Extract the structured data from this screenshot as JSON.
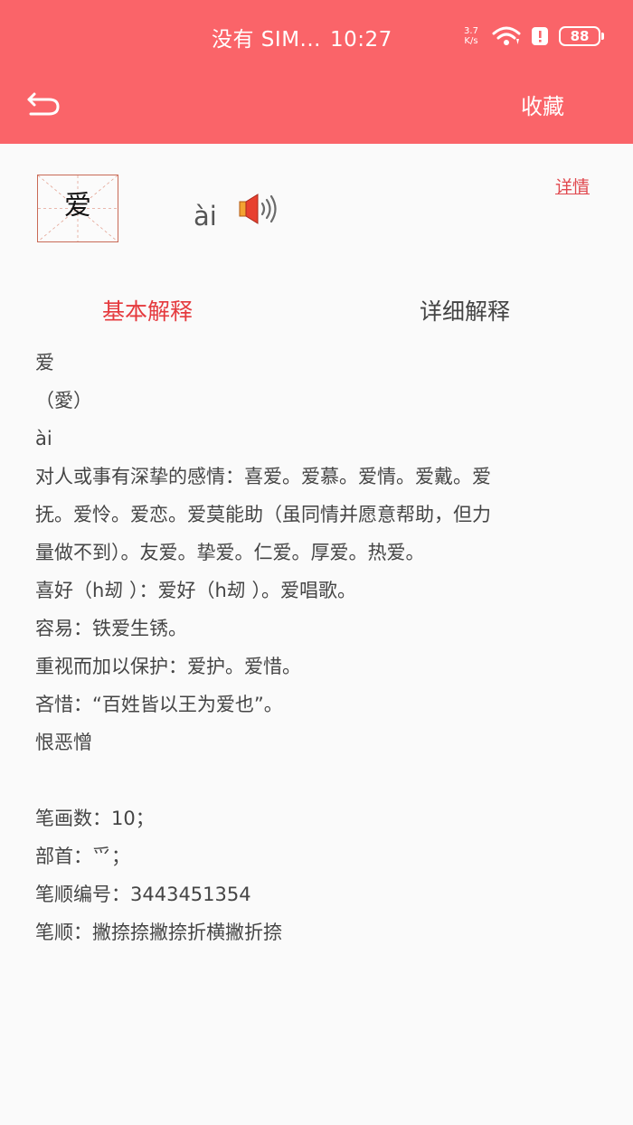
{
  "status_bar": {
    "carrier": "没有 SIM...",
    "time": "10:27",
    "net_speed_value": "3.7",
    "net_speed_unit": "K/s",
    "battery": "88"
  },
  "toolbar": {
    "favorite_label": "收藏"
  },
  "character": {
    "glyph": "爱",
    "pinyin": "ài",
    "detail_link": "详情"
  },
  "tabs": [
    {
      "label": "基本解释",
      "active": true
    },
    {
      "label": "详细解释",
      "active": false
    }
  ],
  "definition": {
    "lines": [
      "爱",
      "（愛）",
      "ài",
      "对人或事有深挚的感情：喜爱。爱慕。爱情。爱戴。爱",
      "抚。爱怜。爱恋。爱莫能助（虽同情并愿意帮助，但力",
      "量做不到）。友爱。挚爱。仁爱。厚爱。热爱。",
      "喜好（h刼 ）：爱好（h刼 ）。爱唱歌。",
      "容易：铁爱生锈。",
      "重视而加以保护：爱护。爱惜。",
      "吝惜：“百姓皆以王为爱也”。",
      "恨恶憎"
    ]
  },
  "info": {
    "strokes": "笔画数：10；",
    "radical": "部首：爫；",
    "stroke_code": "笔顺编号：3443451354",
    "stroke_order": "笔顺：撇捺捺撇捺折横撇折捺"
  },
  "colors": {
    "header": "#fa6469",
    "active_tab": "#e53a3e",
    "box_border": "#c96a56"
  }
}
